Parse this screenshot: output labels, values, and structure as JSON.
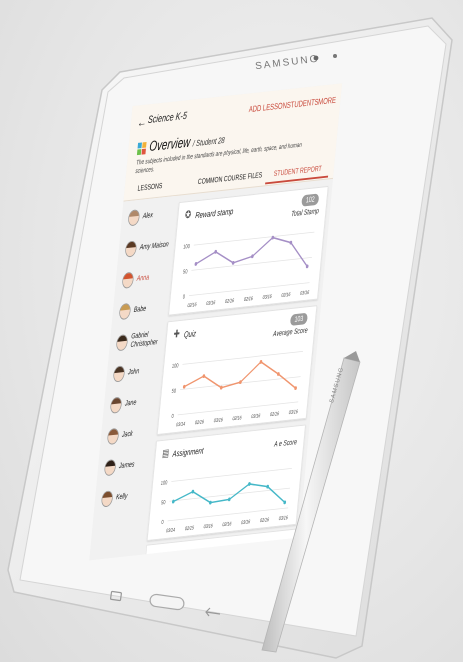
{
  "device": {
    "brand": "SAMSUNG",
    "pen_brand": "SAMSUNG"
  },
  "app": {
    "back_glyph": "←",
    "title": "Science K-5",
    "actions": [
      "ADD LESSON",
      "STUDENTS",
      "MORE"
    ],
    "overview_title": "Overview",
    "overview_student": "/ Student 28",
    "overview_desc": "The subjects included in the standards are physical, life, earth, space, and human sciences.",
    "tabs": [
      {
        "label": "LESSONS",
        "active": false
      },
      {
        "label": "COMMON COURSE FILES",
        "active": false
      },
      {
        "label": "STUDENT REPORT",
        "active": true
      }
    ],
    "accent_color": "#c94a3c"
  },
  "students": [
    {
      "name": "Alex",
      "active": false
    },
    {
      "name": "Amy Maison",
      "active": false
    },
    {
      "name": "Anna",
      "active": true
    },
    {
      "name": "Babe",
      "active": false
    },
    {
      "name": "Gabriel Christopher",
      "active": false
    },
    {
      "name": "John",
      "active": false
    },
    {
      "name": "Jane",
      "active": false
    },
    {
      "name": "Jack",
      "active": false
    },
    {
      "name": "James",
      "active": false
    },
    {
      "name": "Kelly",
      "active": false
    }
  ],
  "chart_data": [
    {
      "type": "line",
      "title": "Reward stamp",
      "badge_value": "102",
      "badge_label": "Total Stamp",
      "icon": "medal-icon",
      "color": "#a58fc6",
      "x": [
        "02/16",
        "03/16",
        "02/16",
        "02/16",
        "03/16",
        "02/16",
        "03/16"
      ],
      "values": [
        62,
        82,
        56,
        65,
        98,
        84,
        33
      ],
      "yticks": [
        0,
        50,
        100
      ],
      "ylim": [
        0,
        120
      ],
      "grid": true
    },
    {
      "type": "line",
      "title": "Quiz",
      "badge_value": "103",
      "badge_label": "Average Score",
      "icon": "puzzle-icon",
      "color": "#f0956e",
      "x": [
        "03/14",
        "02/16",
        "03/16",
        "02/16",
        "03/16",
        "02/16",
        "03/16"
      ],
      "values": [
        55,
        72,
        45,
        52,
        88,
        60,
        28
      ],
      "yticks": [
        0,
        50,
        100
      ],
      "ylim": [
        0,
        120
      ],
      "grid": true
    },
    {
      "type": "line",
      "title": "Assignment",
      "badge_value": "",
      "badge_label": "A      e Score",
      "icon": "document-icon",
      "color": "#45b8c8",
      "x": [
        "03/14",
        "02/15",
        "03/16",
        "02/16",
        "03/16",
        "02/16",
        "03/16"
      ],
      "values": [
        48,
        68,
        35,
        38,
        72,
        60,
        15
      ],
      "yticks": [
        0,
        50,
        100
      ],
      "ylim": [
        0,
        120
      ],
      "grid": true
    }
  ]
}
